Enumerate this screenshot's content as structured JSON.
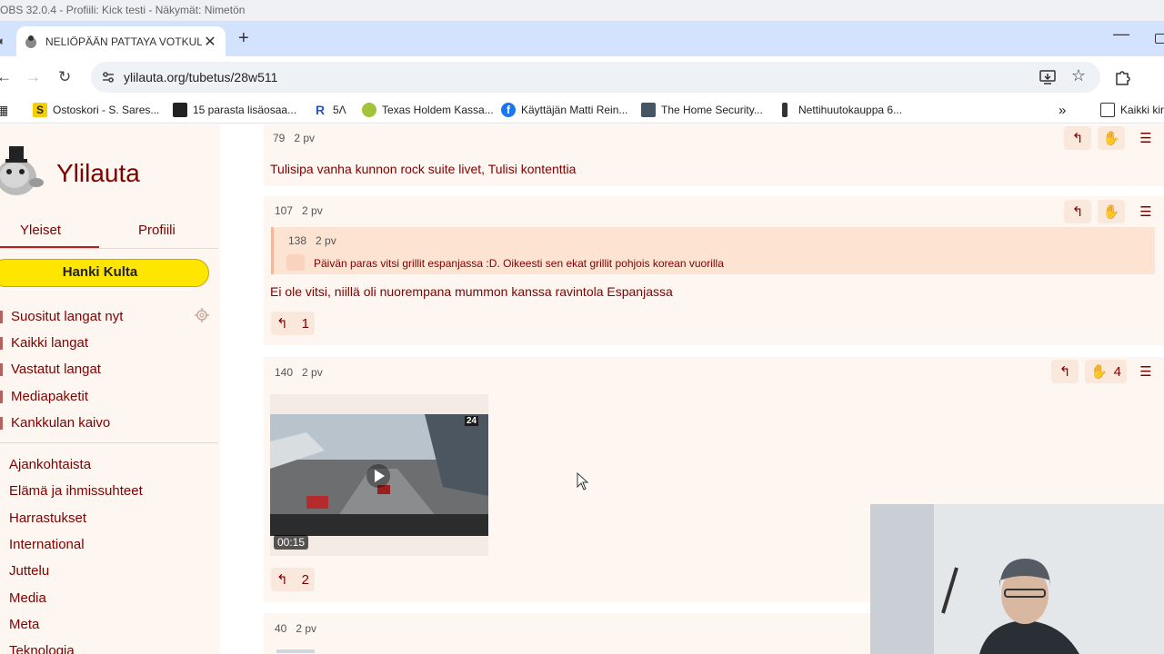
{
  "obs": {
    "title": "OBS 32.0.4 - Profiili: Kick testi - Näkymät: Nimetön"
  },
  "browser": {
    "tab_title": "NELIÖPÄÄN PATTAYA VOTKULI...",
    "url": "ylilauta.org/tubetus/28w511",
    "bookmarks": [
      {
        "label": "Ostoskori - S. Sares...",
        "color": "#f5d000",
        "icon": "s-icon"
      },
      {
        "label": "15 parasta lisäosaa...",
        "color": "#222222",
        "icon": "film-icon"
      },
      {
        "label": "5Λ",
        "color": "#2255cc",
        "icon": "r-icon"
      },
      {
        "label": "Texas Holdem Kassa...",
        "color": "#a3c43a",
        "icon": "poker-icon"
      },
      {
        "label": "Käyttäjän Matti Rein...",
        "color": "#1877f2",
        "icon": "facebook-icon"
      },
      {
        "label": "The Home Security...",
        "color": "#445566",
        "icon": "site-icon"
      },
      {
        "label": "Nettihuutokauppa 6...",
        "color": "#333333",
        "icon": "hammer-icon"
      }
    ],
    "bookmarks_more": "»",
    "bookmarks_folder": "Kaikki kir"
  },
  "sidebar": {
    "site_name": "Ylilauta",
    "tabs": [
      "Yleiset",
      "Profiili"
    ],
    "gold_button": "Hanki Kulta",
    "links_top": [
      "Suositut langat nyt",
      "Kaikki langat",
      "Vastatut langat",
      "Mediapaketit",
      "Kankkulan kaivo"
    ],
    "links_boards": [
      "Ajankohtaista",
      "Elämä ja ihmissuhteet",
      "Harrastukset",
      "International",
      "Juttelu",
      "Media",
      "Meta",
      "Teknologia"
    ]
  },
  "posts": [
    {
      "id": "79",
      "age": "2 pv",
      "text": "Tulisipa vanha kunnon rock suite livet, Tulisi kontenttia"
    },
    {
      "id": "107",
      "age": "2 pv",
      "quote": {
        "id": "138",
        "age": "2 pv",
        "text": "Päivän paras vitsi grillit espanjassa :D. Oikeesti sen ekat grillit pohjois korean vuorilla"
      },
      "text": "Ei ole vitsi, niillä oli nuorempana mummon kanssa ravintola Espanjassa",
      "replies": "1"
    },
    {
      "id": "140",
      "age": "2 pv",
      "likes": "4",
      "video_duration": "00:15",
      "video_badge": "24",
      "replies": "2"
    },
    {
      "id": "40",
      "age": "2 pv"
    }
  ],
  "colors": {
    "accent": "#800000",
    "gold": "#ffe600",
    "post_bg": "#fef6f0"
  }
}
